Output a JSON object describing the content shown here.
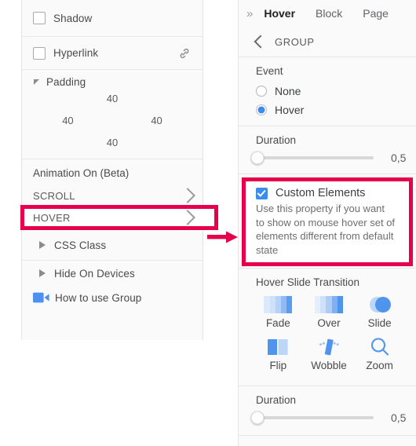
{
  "colors": {
    "accent_blue": "#3c8ceb",
    "highlight_red": "#e6004c",
    "panel_bg": "#fafafa",
    "text": "#4a4a4a"
  },
  "left_panel": {
    "shadow": {
      "label": "Shadow",
      "checked": false
    },
    "hyperlink": {
      "label": "Hyperlink",
      "checked": false,
      "icon": "link-icon"
    },
    "padding": {
      "label": "Padding",
      "expanded": true,
      "top": "40",
      "left": "40",
      "right": "40",
      "bottom": "40"
    },
    "animation": {
      "title": "Animation On (Beta)",
      "rows": [
        {
          "label": "SCROLL",
          "highlighted": false
        },
        {
          "label": "HOVER",
          "highlighted": true
        }
      ]
    },
    "css_class": {
      "label": "CSS Class",
      "expanded": false
    },
    "hide_on_devices": {
      "label": "Hide On Devices",
      "expanded": false
    },
    "how_to": {
      "label": "How to use Group",
      "icon": "video-camera-icon"
    }
  },
  "right_panel": {
    "overflow_icon": "»",
    "tabs": [
      {
        "label": "Hover",
        "active": true
      },
      {
        "label": "Block",
        "active": false
      },
      {
        "label": "Page",
        "active": false
      }
    ],
    "breadcrumb": {
      "back_icon": "chevron-left-icon",
      "label": "GROUP"
    },
    "event": {
      "title": "Event",
      "options": [
        {
          "label": "None",
          "selected": false
        },
        {
          "label": "Hover",
          "selected": true
        }
      ]
    },
    "duration_top": {
      "title": "Duration",
      "value": "0,5",
      "percent": 2
    },
    "custom_elements": {
      "label": "Custom Elements",
      "checked": true,
      "description": "Use this property if you want to show on mouse hover set of elements different from default state",
      "highlighted": true
    },
    "transition": {
      "title": "Hover Slide Transition",
      "items": [
        {
          "label": "Fade",
          "icon": "fade-bars-icon"
        },
        {
          "label": "Over",
          "icon": "over-bars-icon"
        },
        {
          "label": "Slide",
          "icon": "slide-circles-icon"
        },
        {
          "label": "Flip",
          "icon": "flip-panels-icon"
        },
        {
          "label": "Wobble",
          "icon": "wobble-icon"
        },
        {
          "label": "Zoom",
          "icon": "magnifier-icon"
        }
      ]
    },
    "duration_bottom": {
      "title": "Duration",
      "value": "0,5",
      "percent": 2
    }
  },
  "annotation": {
    "arrow": "red-arrow-right"
  }
}
